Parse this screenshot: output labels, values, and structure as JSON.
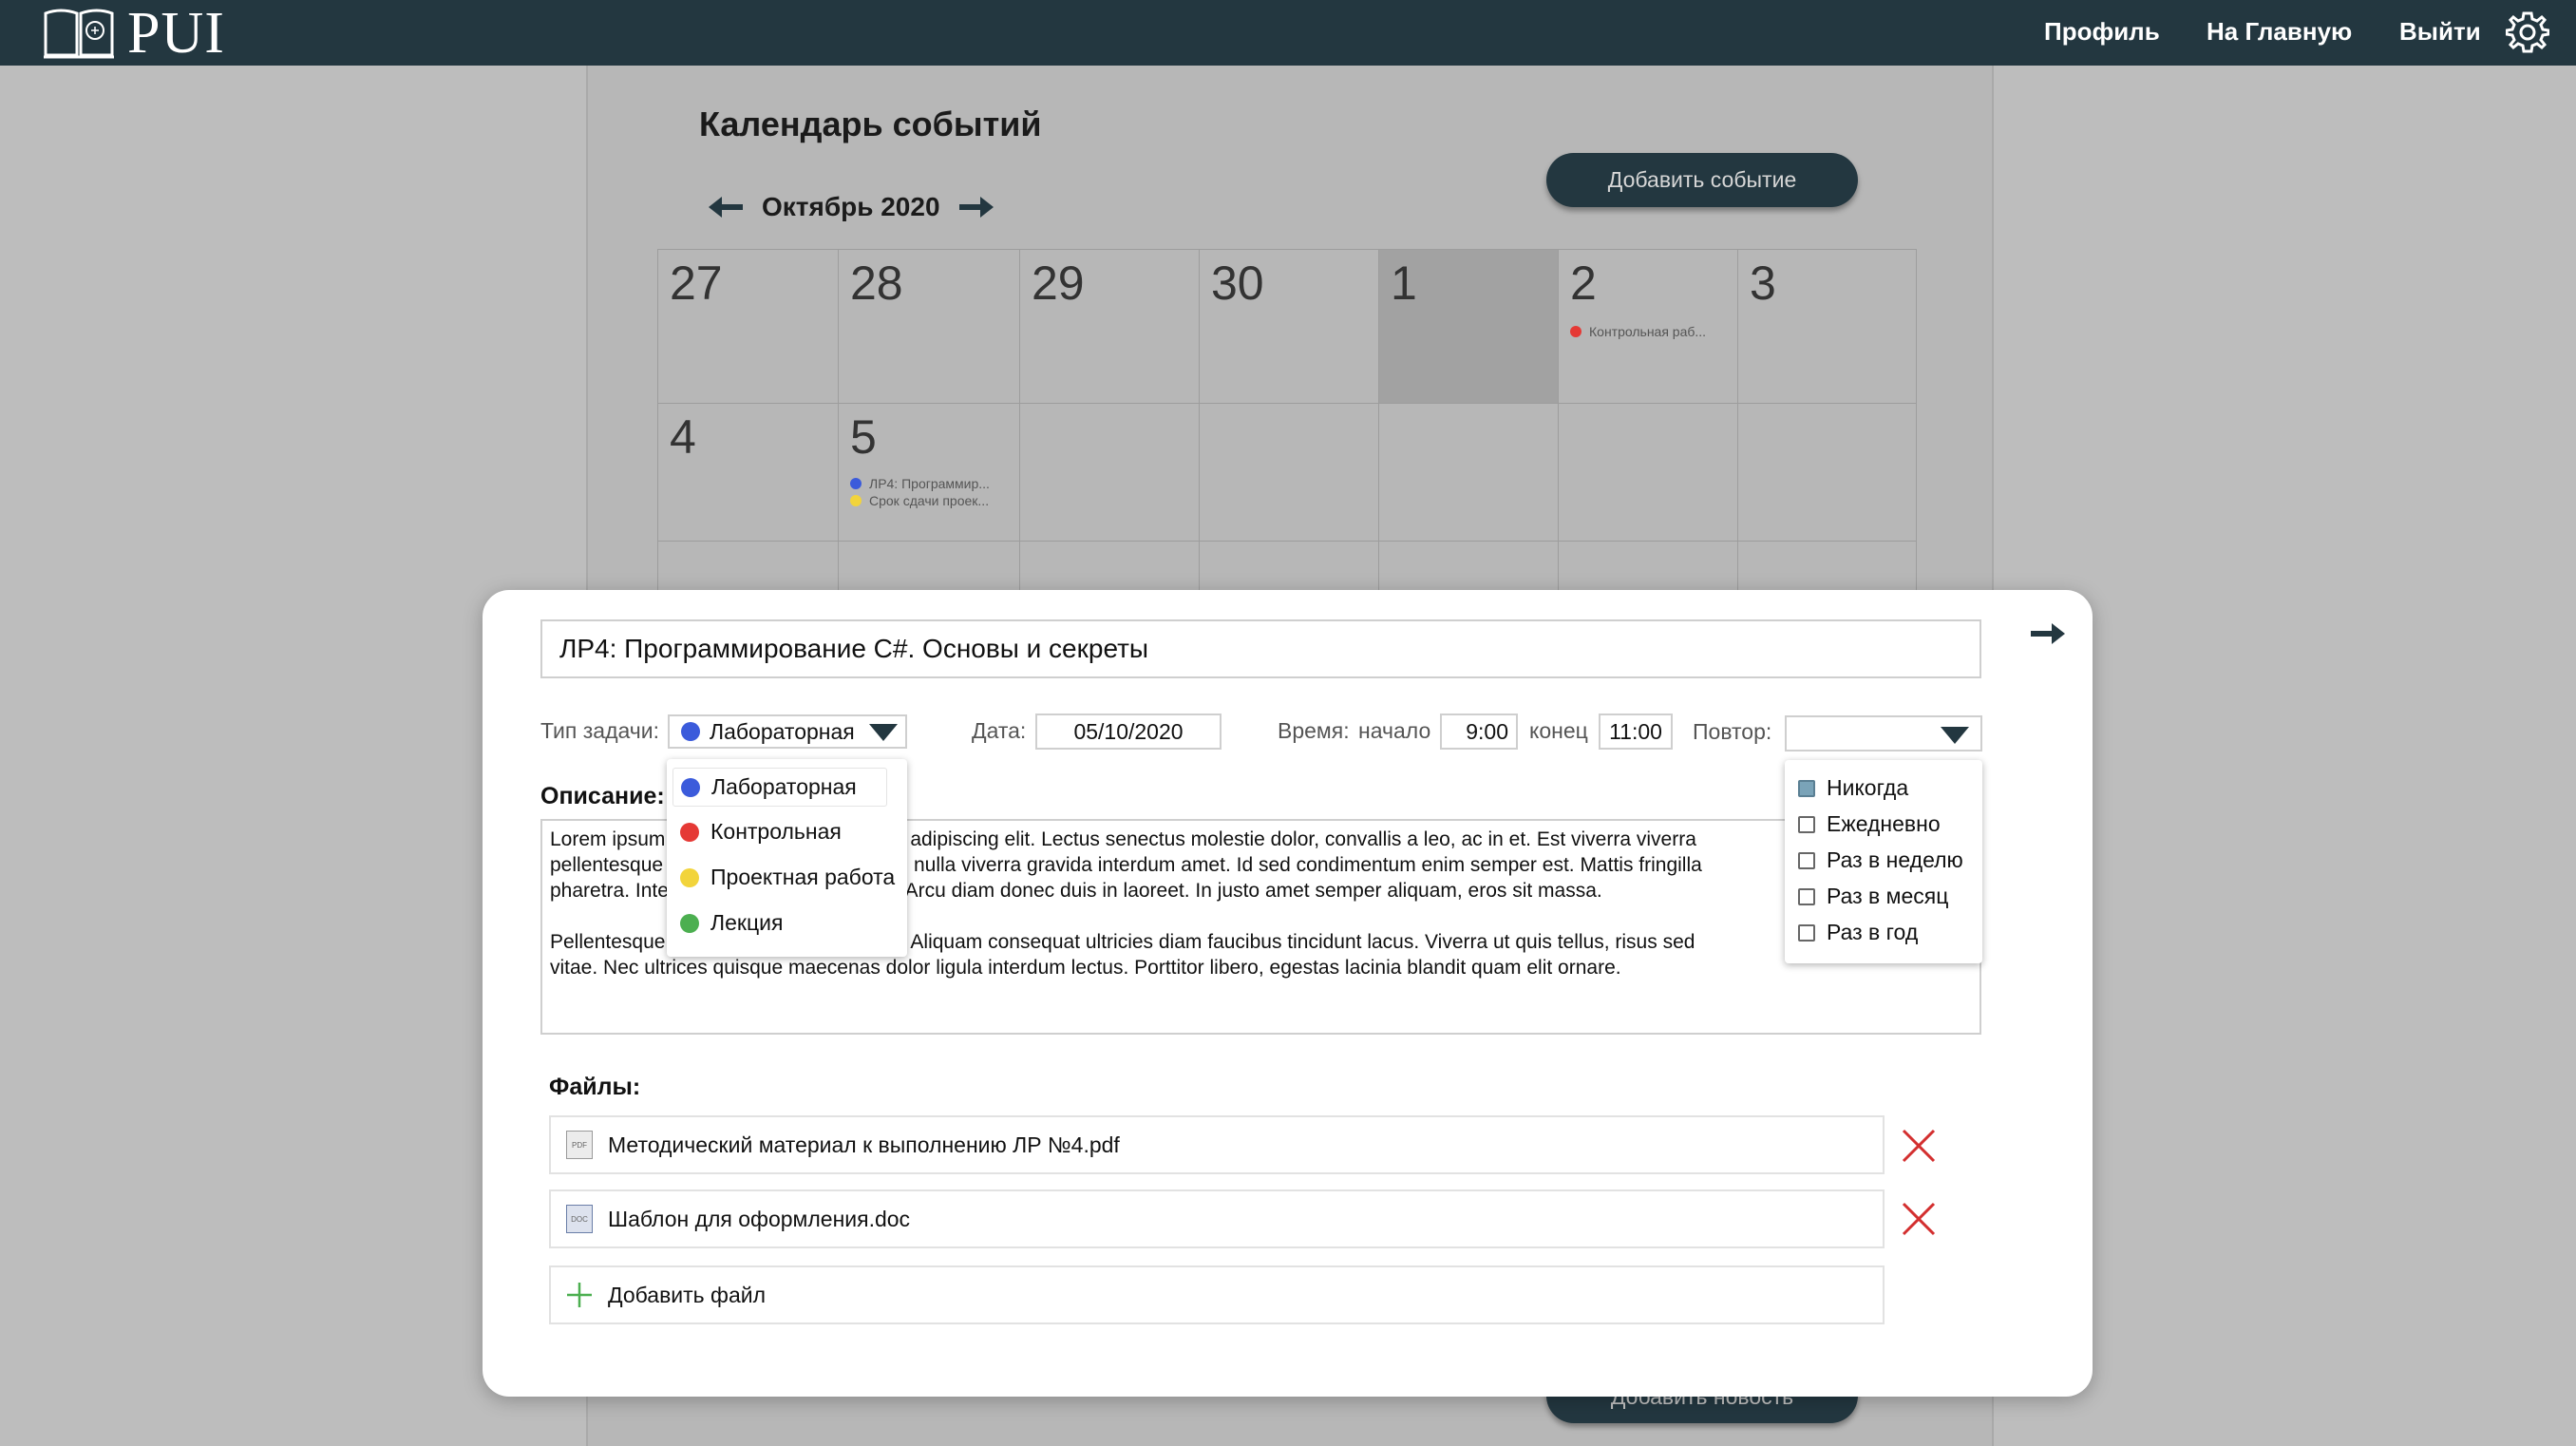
{
  "navbar": {
    "logo_text": "PUI",
    "links": [
      "Профиль",
      "На Главную",
      "Выйти"
    ]
  },
  "calendar": {
    "title": "Календарь событий",
    "month": "Октябрь 2020",
    "add_event_label": "Добавить событие",
    "add_news_label": "Добавить новость",
    "week1": [
      "27",
      "28",
      "29",
      "30",
      "1",
      "2",
      "3"
    ],
    "week2": [
      "4",
      "5"
    ],
    "events": {
      "oct2": [
        {
          "text": "Контрольная раб...",
          "color": "#e53935"
        }
      ],
      "oct5": [
        {
          "text": "ЛР4: Программир...",
          "color": "#3b5bdb"
        },
        {
          "text": "Срок сдачи проек...",
          "color": "#f2d43b"
        }
      ]
    }
  },
  "modal": {
    "title": "ЛР4: Программирование C#. Основы и секреты",
    "type_label": "Тип задачи:",
    "type_value": "Лабораторная",
    "type_options": [
      {
        "label": "Лабораторная",
        "color": "#3b5bdb"
      },
      {
        "label": "Контрольная",
        "color": "#e53935"
      },
      {
        "label": "Проектная работа",
        "color": "#f2d43b"
      },
      {
        "label": "Лекция",
        "color": "#4caf50"
      }
    ],
    "date_label": "Дата:",
    "date_value": "05/10/2020",
    "time_label": "Время:",
    "start_label": "начало",
    "start_value": "9:00",
    "end_label": "конец",
    "end_value": "11:00",
    "repeat_label": "Повтор:",
    "repeat_options": [
      "Никогда",
      "Ежедневно",
      "Раз в неделю",
      "Раз в месяц",
      "Раз в год"
    ],
    "description_label": "Описание:",
    "description": "Lorem ipsum dolor sit amet, consectetur adipiscing elit. Lectus senectus molestie dolor, convallis a leo, ac in et. Est viverra viverra\npellentesque eget. Id et pellentesque dui nulla viverra gravida interdum amet. Id sed condimentum enim semper est. Mattis fringilla\npharetra. Integer sagittis consequat leo. Arcu diam donec duis in laoreet. In justo amet semper aliquam, eros sit massa.\n\nPellentesque scelerisque dui egestas in. Aliquam consequat ultricies diam faucibus tincidunt lacus. Viverra ut quis tellus, risus sed\nvitae. Nec ultrices quisque maecenas dolor ligula interdum lectus. Porttitor libero, egestas lacinia blandit quam elit ornare.",
    "files_label": "Файлы:",
    "files": [
      {
        "name": "Методический материал к выполнению ЛР №4.pdf",
        "ext": "PDF"
      },
      {
        "name": "Шаблон для оформления.doc",
        "ext": "DOC"
      }
    ],
    "add_file_label": "Добавить файл"
  },
  "colors": {
    "navbar": "#233740",
    "accent": "#233740",
    "delete": "#d32f2f",
    "add": "#4caf50"
  }
}
